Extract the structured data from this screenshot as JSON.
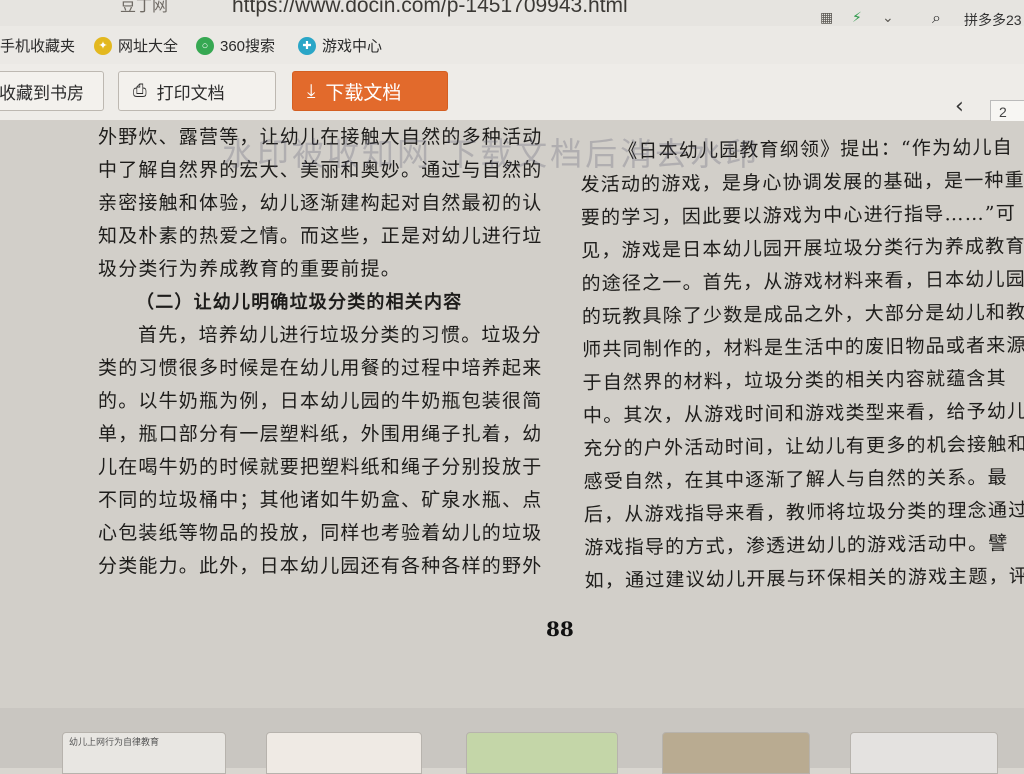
{
  "browser": {
    "site_name": "豆丁网",
    "url": "https://www.docin.com/p-1451709943.html",
    "extra_tab": "拼多多23"
  },
  "bookmarks": [
    {
      "label": "手机收藏夹",
      "icon": "phone-icon"
    },
    {
      "label": "网址大全",
      "icon": "star-icon"
    },
    {
      "label": "360搜索",
      "icon": "search-icon"
    },
    {
      "label": "游戏中心",
      "icon": "gamepad-icon"
    }
  ],
  "toolbar": {
    "save_label": "收藏到书房",
    "print_label": "打印文档",
    "download_label": "下载文档"
  },
  "watermark": "水印被收知网 下载文档后消去水印",
  "document": {
    "left_column": [
      "外野炊、露营等，让幼儿在接触大自然的多种活动",
      "中了解自然界的宏大、美丽和奥妙。通过与自然的",
      "亲密接触和体验，幼儿逐渐建构起对自然最初的认",
      "知及朴素的热爱之情。而这些，正是对幼儿进行垃",
      "圾分类行为养成教育的重要前提。",
      "（二）让幼儿明确垃圾分类的相关内容",
      "首先，培养幼儿进行垃圾分类的习惯。垃圾分",
      "类的习惯很多时候是在幼儿用餐的过程中培养起来",
      "的。以牛奶瓶为例，日本幼儿园的牛奶瓶包装很简",
      "单，瓶口部分有一层塑料纸，外围用绳子扎着，幼",
      "儿在喝牛奶的时候就要把塑料纸和绳子分别投放于",
      "不同的垃圾桶中；其他诸如牛奶盒、矿泉水瓶、点",
      "心包装纸等物品的投放，同样也考验着幼儿的垃圾",
      "分类能力。此外，日本幼儿园还有各种各样的野外"
    ],
    "right_column": [
      "《日本幼儿园教育纲领》提出：“作为幼儿自",
      "发活动的游戏，是身心协调发展的基础，是一种重",
      "要的学习，因此要以游戏为中心进行指导……”可",
      "见，游戏是日本幼儿园开展垃圾分类行为养成教育",
      "的途径之一。首先，从游戏材料来看，日本幼儿园",
      "的玩教具除了少数是成品之外，大部分是幼儿和教",
      "师共同制作的，材料是生活中的废旧物品或者来源",
      "于自然界的材料，垃圾分类的相关内容就蕴含其",
      "中。其次，从游戏时间和游戏类型来看，给予幼儿",
      "充分的户外活动时间，让幼儿有更多的机会接触和",
      "感受自然，在其中逐渐了解人与自然的关系。最",
      "后，从游戏指导来看，教师将垃圾分类的理念通过",
      "游戏指导的方式，渗透进幼儿的游戏活动中。譬",
      "如，通过建议幼儿开展与环保相关的游戏主题，评"
    ],
    "page_number": "88",
    "page_box": "2"
  },
  "thumbnails": [
    {
      "caption": "幼儿上网行为自律教育"
    },
    {
      "caption": ""
    },
    {
      "caption": ""
    },
    {
      "caption": ""
    },
    {
      "caption": ""
    }
  ],
  "colors": {
    "accent": "#e26a2c",
    "page_bg": "#d2cfc9",
    "chrome_bg": "#eeece8"
  }
}
